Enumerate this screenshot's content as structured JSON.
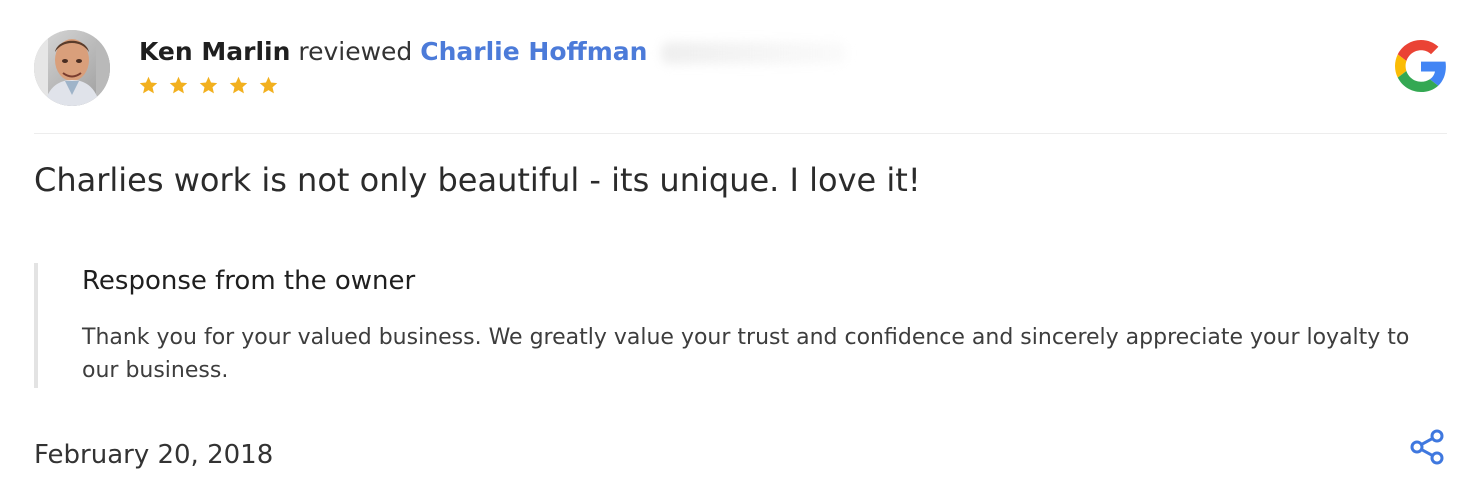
{
  "review": {
    "reviewer_name": "Ken Marlin",
    "action_text": "reviewed",
    "business_name": "Charlie Hoffman",
    "rating": 5,
    "body": "Charlies work is not only beautiful - its unique. I love it!",
    "date": "February 20, 2018"
  },
  "owner_response": {
    "title": "Response from the owner",
    "text": "Thank you for your valued business. We greatly value your trust and confidence and sincerely appreciate your loyalty to our business."
  },
  "icons": {
    "platform": "google-icon",
    "share": "share-icon",
    "star": "star-icon"
  },
  "colors": {
    "link": "#4c7bd9",
    "star": "#f2b01e",
    "share": "#3f78df",
    "google_blue": "#4285F4",
    "google_red": "#EA4335",
    "google_yellow": "#FBBC05",
    "google_green": "#34A853"
  }
}
